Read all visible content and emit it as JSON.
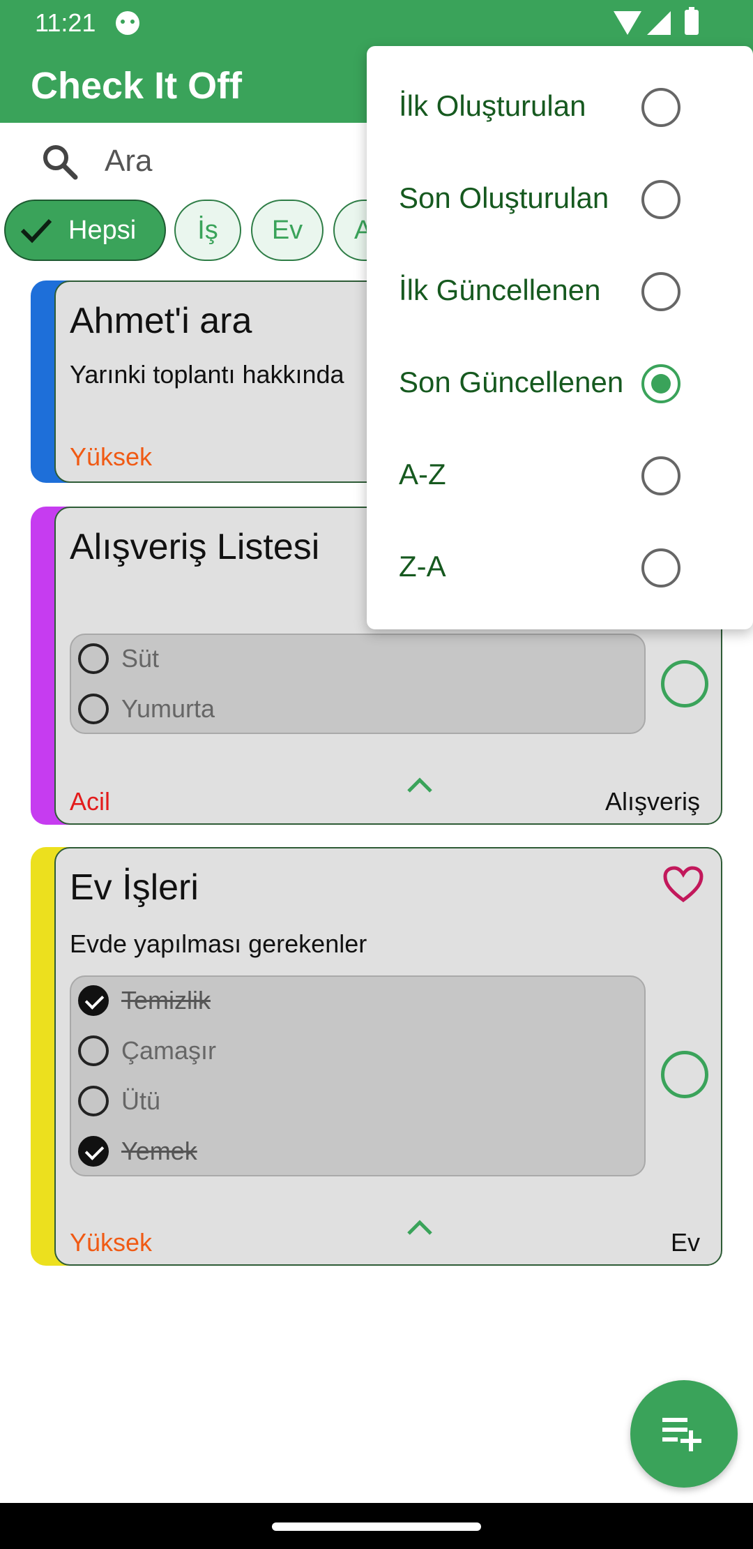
{
  "status_bar": {
    "time": "11:21"
  },
  "app_bar": {
    "title": "Check It Off"
  },
  "search": {
    "placeholder": "Ara"
  },
  "chips": [
    {
      "label": "Hepsi",
      "selected": true
    },
    {
      "label": "İş",
      "selected": false
    },
    {
      "label": "Ev",
      "selected": false
    },
    {
      "label": "A",
      "selected": false
    }
  ],
  "notes": [
    {
      "title": "Ahmet'i ara",
      "description": "Yarınki toplantı hakkında",
      "priority": "Yüksek",
      "priority_color": "#f05a14",
      "stripe_color": "#1e6fd9",
      "category": ""
    },
    {
      "title": "Alışveriş Listesi",
      "description": "",
      "items": [
        {
          "text": "Süt",
          "checked": false
        },
        {
          "text": "Yumurta",
          "checked": false
        }
      ],
      "priority": "Acil",
      "priority_color": "#e31c1c",
      "stripe_color": "#c63cf0",
      "category": "Alışveriş"
    },
    {
      "title": "Ev İşleri",
      "description": "Evde yapılması gerekenler",
      "items": [
        {
          "text": "Temizlik",
          "checked": true
        },
        {
          "text": "Çamaşır",
          "checked": false
        },
        {
          "text": "Ütü",
          "checked": false
        },
        {
          "text": "Yemek",
          "checked": true
        }
      ],
      "priority": "Yüksek",
      "priority_color": "#f05a14",
      "stripe_color": "#ece01e",
      "category": "Ev",
      "favorite": true
    }
  ],
  "sort_menu": {
    "options": [
      {
        "label": "İlk Oluşturulan",
        "selected": false
      },
      {
        "label": "Son Oluşturulan",
        "selected": false
      },
      {
        "label": "İlk Güncellenen",
        "selected": false
      },
      {
        "label": "Son Güncellenen",
        "selected": true
      },
      {
        "label": "A-Z",
        "selected": false
      },
      {
        "label": "Z-A",
        "selected": false
      }
    ]
  },
  "colors": {
    "primary": "#3aa35a",
    "card": "#e0e0e0",
    "menu_text": "#16591f"
  }
}
